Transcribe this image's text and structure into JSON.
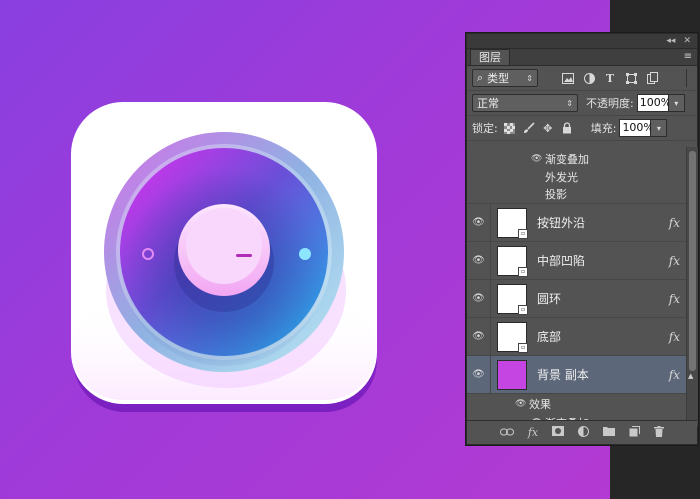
{
  "panel": {
    "tab_label": "图层",
    "collapse_glyph": "◂◂",
    "close_glyph": "✕",
    "menu_glyph": "≡",
    "filter": {
      "search_glyph": "⌕",
      "value": "类型"
    },
    "blend_mode": "正常",
    "opacity_label": "不透明度:",
    "opacity_value": "100%",
    "lock_label": "锁定:",
    "fill_label": "填充:",
    "fill_value": "100%"
  },
  "effects_top": [
    "渐变叠加",
    "外发光",
    "投影"
  ],
  "layers": [
    {
      "name": "按钮外沿",
      "fx": "fx"
    },
    {
      "name": "中部凹陷",
      "fx": "fx"
    },
    {
      "name": "圆环",
      "fx": "fx"
    },
    {
      "name": "底部",
      "fx": "fx"
    },
    {
      "name": "背景 副本",
      "fx": "fx",
      "selected": true
    }
  ],
  "effects_bottom": {
    "header": "效果",
    "items": [
      "渐变叠加"
    ]
  },
  "bottom_toolbar": [
    "link-icon",
    "fx-icon",
    "mask-icon",
    "adjustment-icon",
    "folder-icon",
    "new-layer-icon",
    "trash-icon"
  ],
  "colors": {
    "background": "#9a3cde",
    "panel": "#535353",
    "selected_layer": "#5c6779",
    "icon_pink": "#e23bf0",
    "icon_blue": "#2aa7e8"
  }
}
